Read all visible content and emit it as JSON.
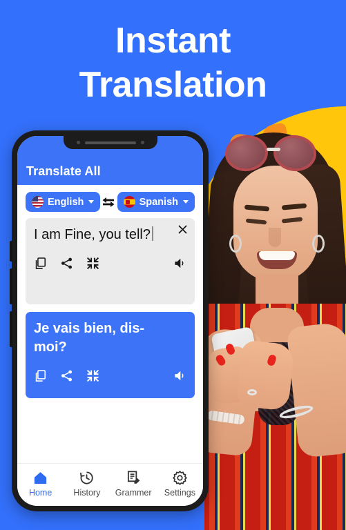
{
  "theme": {
    "background_blue": "#3370FB",
    "accent_blue": "#3D74F7",
    "yellow": "#FFC60B",
    "orange_splash": "#F68B1F",
    "input_card_gray": "#EBEBEB",
    "active_nav_blue": "#2F6BF0"
  },
  "promo": {
    "headline_line1": "Instant",
    "headline_line2": "Translation"
  },
  "phone": {
    "app": {
      "header": {
        "title": "Translate All"
      },
      "language_bar": {
        "source": {
          "label": "English",
          "flag": "us-flag-icon",
          "caret": "chevron-down-icon"
        },
        "swap": {
          "icon": "swap-arrows-icon"
        },
        "target": {
          "label": "Spanish",
          "flag": "es-flag-icon",
          "caret": "chevron-down-icon"
        }
      },
      "input_card": {
        "text": "I am Fine, you tell?",
        "has_cursor": true,
        "close_icon": "close-icon",
        "actions": [
          {
            "name": "copy-icon",
            "label": "Copy"
          },
          {
            "name": "share-icon",
            "label": "Share"
          },
          {
            "name": "collapse-icon",
            "label": "Collapse"
          }
        ],
        "speak_icon": "speaker-icon"
      },
      "output_card": {
        "text": "Je vais bien, dis-moi?",
        "actions": [
          {
            "name": "copy-icon",
            "label": "Copy"
          },
          {
            "name": "share-icon",
            "label": "Share"
          },
          {
            "name": "collapse-icon",
            "label": "Collapse"
          }
        ],
        "speak_icon": "speaker-icon"
      },
      "bottom_nav": [
        {
          "label": "Home",
          "icon": "home-icon",
          "active": true
        },
        {
          "label": "History",
          "icon": "history-clock-icon",
          "active": false
        },
        {
          "label": "Grammer",
          "icon": "grammar-document-pencil-icon",
          "active": false
        },
        {
          "label": "Settings",
          "icon": "gear-icon",
          "active": false
        }
      ]
    }
  },
  "photo": {
    "description": "woman-with-sunglasses-holding-phone"
  }
}
